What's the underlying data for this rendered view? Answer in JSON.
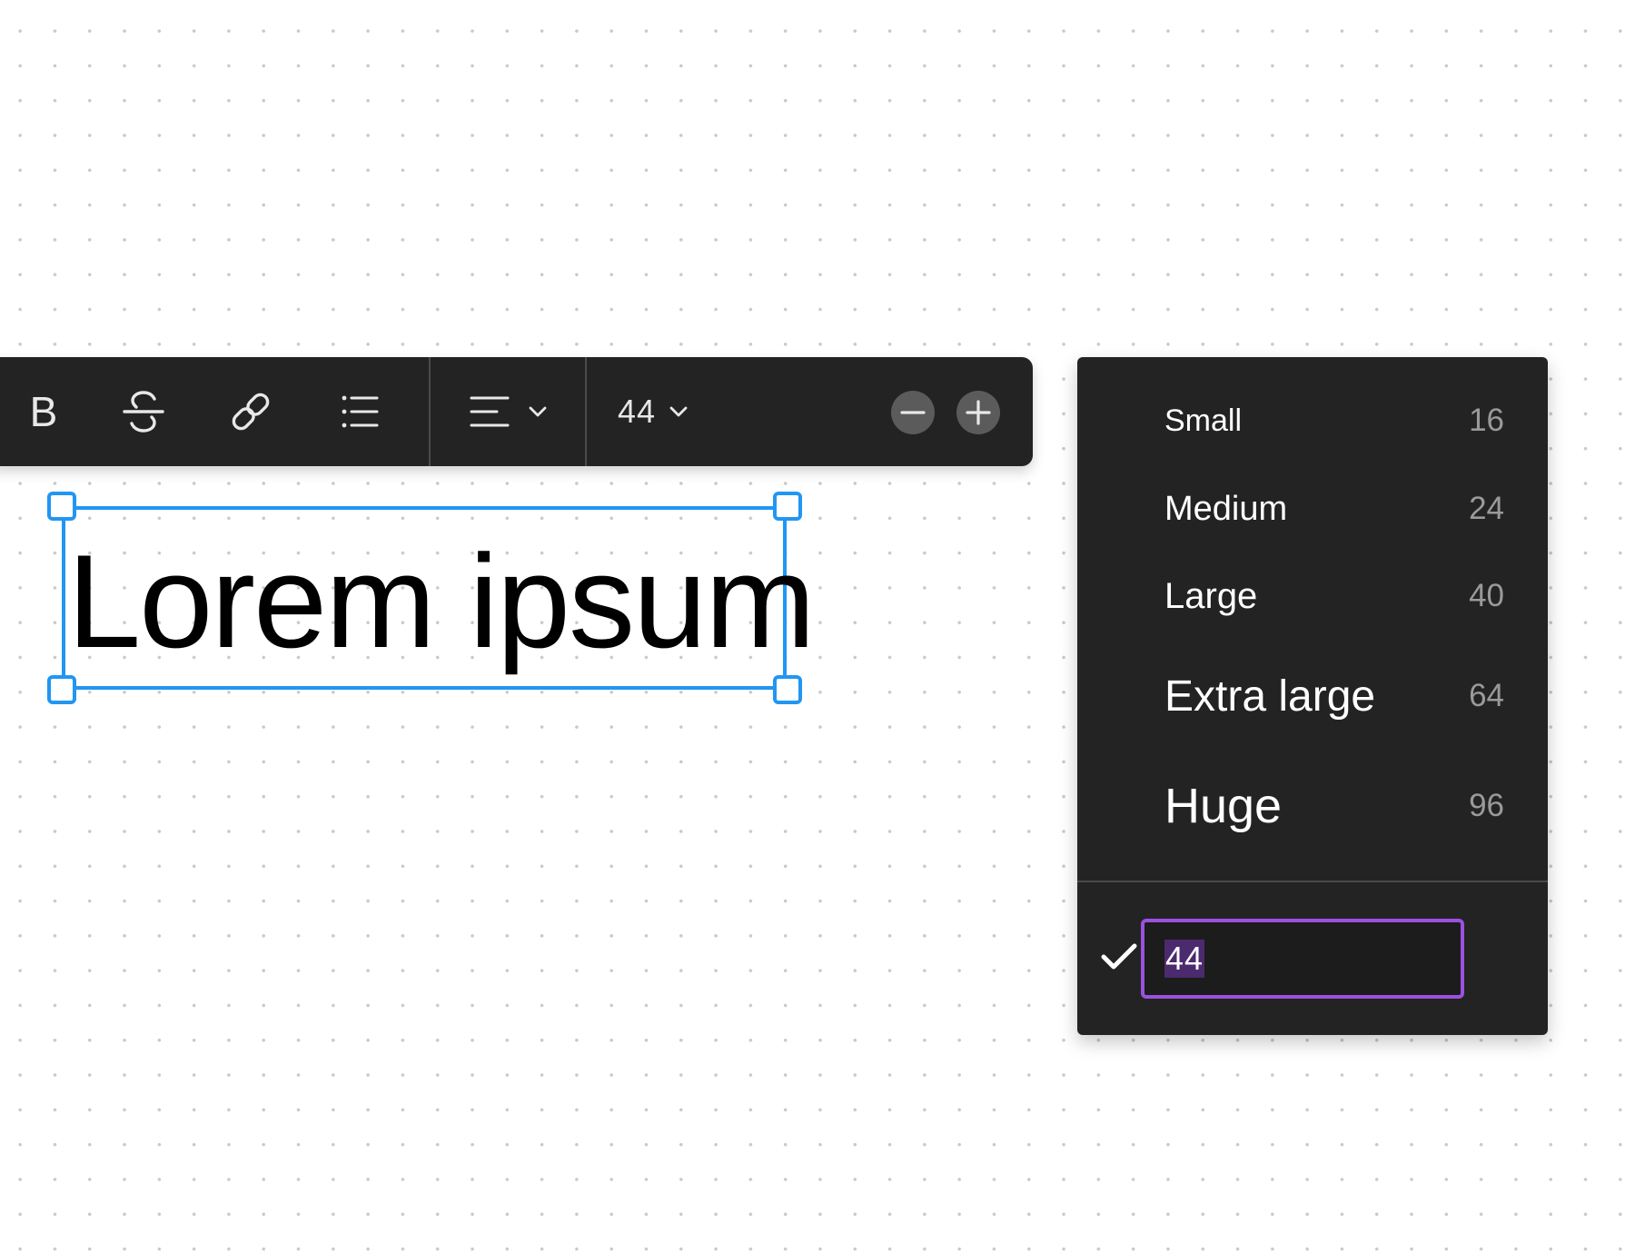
{
  "toolbar": {
    "bold_label": "B",
    "font_size_value": "44",
    "icons": {
      "bold": "bold-icon",
      "strikethrough": "strikethrough-icon",
      "link": "link-icon",
      "list": "bulleted-list-icon",
      "align": "align-left-icon",
      "chevron": "chevron-down-icon",
      "decrease": "minus-circle-icon",
      "increase": "plus-circle-icon"
    }
  },
  "canvas": {
    "text": "Lorem ipsum",
    "selection_color": "#2196f3"
  },
  "font_size_menu": {
    "items": [
      {
        "label": "Small",
        "value": "16"
      },
      {
        "label": "Medium",
        "value": "24"
      },
      {
        "label": "Large",
        "value": "40"
      },
      {
        "label": "Extra large",
        "value": "64"
      },
      {
        "label": "Huge",
        "value": "96"
      }
    ],
    "custom_value": "44",
    "custom_checked": true,
    "input_focus_color": "#9b51e0"
  }
}
